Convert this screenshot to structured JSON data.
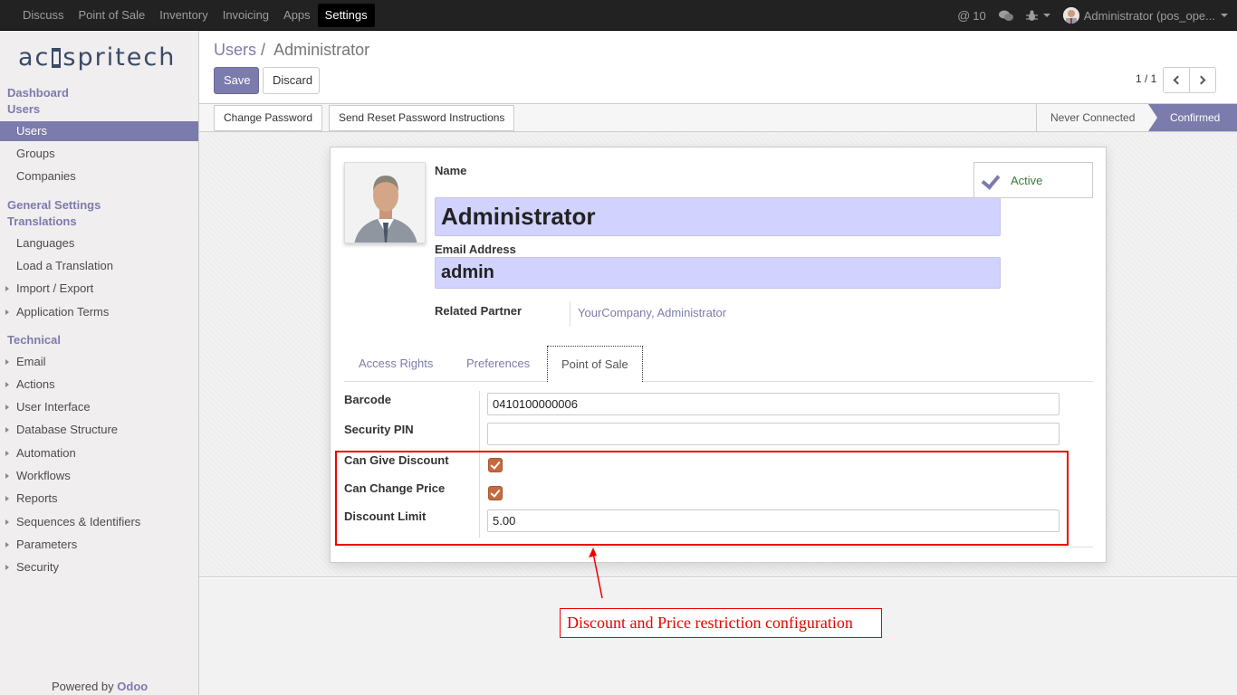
{
  "topbar": {
    "menu": [
      "Discuss",
      "Point of Sale",
      "Inventory",
      "Invoicing",
      "Apps",
      "Settings"
    ],
    "active_menu": "Settings",
    "messages_count": "10",
    "user_label": "Administrator (pos_ope..."
  },
  "sidebar": {
    "logo_text_left": "ac",
    "logo_text_right": "spritech",
    "sections": {
      "dashboard": "Dashboard",
      "users": "Users",
      "general_settings": "General Settings",
      "translations": "Translations",
      "technical": "Technical"
    },
    "users_items": [
      "Users",
      "Groups",
      "Companies"
    ],
    "translation_items": [
      "Languages",
      "Load a Translation",
      "Import / Export",
      "Application Terms"
    ],
    "technical_items": [
      "Email",
      "Actions",
      "User Interface",
      "Database Structure",
      "Automation",
      "Workflows",
      "Reports",
      "Sequences & Identifiers",
      "Parameters",
      "Security"
    ],
    "powered_prefix": "Powered by",
    "powered_brand": "Odoo"
  },
  "control": {
    "breadcrumb_parent": "Users",
    "breadcrumb_sep": "/",
    "breadcrumb_current": "Administrator",
    "save_label": "Save",
    "discard_label": "Discard",
    "pager": "1 / 1"
  },
  "statusbar": {
    "change_password": "Change Password",
    "send_reset": "Send Reset Password Instructions",
    "stage_never": "Never Connected",
    "stage_confirmed": "Confirmed"
  },
  "form": {
    "name_label": "Name",
    "name_value": "Administrator",
    "email_label": "Email Address",
    "email_value": "admin",
    "active_label": "Active",
    "related_partner_label": "Related Partner",
    "related_partner_value": "YourCompany, Administrator",
    "tabs": [
      "Access Rights",
      "Preferences",
      "Point of Sale"
    ],
    "active_tab": "Point of Sale",
    "barcode_label": "Barcode",
    "barcode_value": "0410100000006",
    "security_pin_label": "Security PIN",
    "security_pin_value": "",
    "can_give_discount_label": "Can Give Discount",
    "can_give_discount": true,
    "can_change_price_label": "Can Change Price",
    "can_change_price": true,
    "discount_limit_label": "Discount Limit",
    "discount_limit_value": "5.00"
  },
  "annotation": {
    "text": "Discount and Price restriction configuration",
    "color": "#e00000"
  },
  "colors": {
    "brand": "#7c7bad",
    "checkbox": "#c56a3f",
    "required_field": "#d2d2ff"
  }
}
